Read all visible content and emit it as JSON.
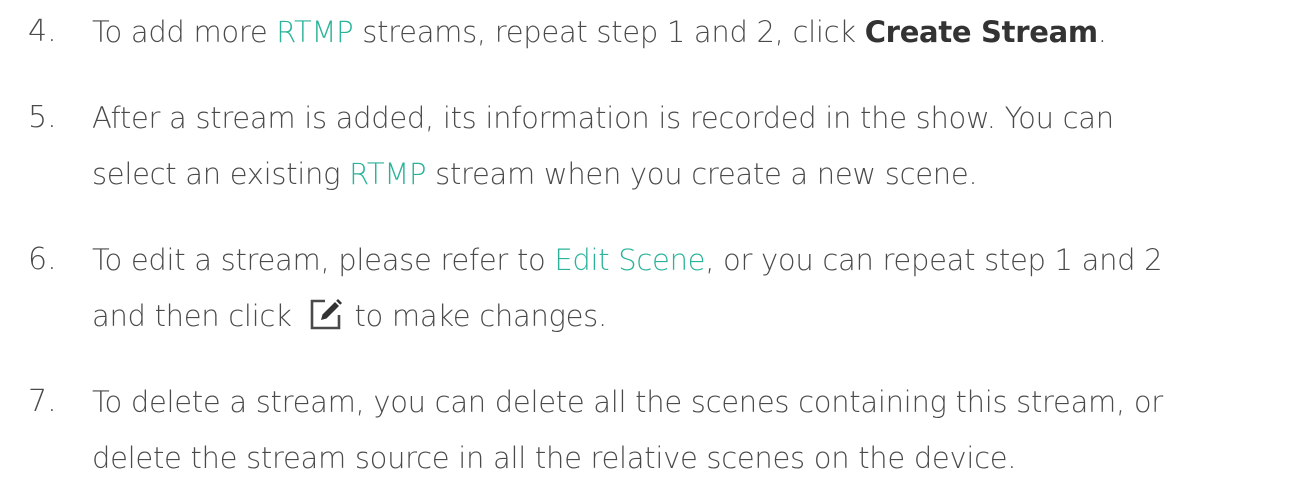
{
  "steps": [
    {
      "number": "4.",
      "lines": [
        {
          "parts": [
            {
              "text": "To add more ",
              "style": "plain"
            },
            {
              "text": "RTMP",
              "style": "link"
            },
            {
              "text": " streams, repeat step 1 and 2, click ",
              "style": "plain"
            },
            {
              "text": "Create Stream",
              "style": "bold"
            },
            {
              "text": ".",
              "style": "plain"
            }
          ]
        }
      ]
    },
    {
      "number": "5.",
      "lines": [
        {
          "parts": [
            {
              "text": "After a stream is added, its information is recorded in the show. You can",
              "style": "plain"
            }
          ]
        },
        {
          "parts": [
            {
              "text": "select an existing ",
              "style": "plain"
            },
            {
              "text": "RTMP",
              "style": "link"
            },
            {
              "text": " stream when you create a new scene.",
              "style": "plain"
            }
          ]
        }
      ]
    },
    {
      "number": "6.",
      "lines": [
        {
          "parts": [
            {
              "text": "To edit a stream, please refer to ",
              "style": "plain"
            },
            {
              "text": "Edit Scene",
              "style": "link"
            },
            {
              "text": ", or you can repeat step 1 and 2",
              "style": "plain"
            }
          ]
        },
        {
          "parts": [
            {
              "text": "and then click ",
              "style": "plain"
            },
            {
              "icon": "edit-icon"
            },
            {
              "text": "to make changes.",
              "style": "plain"
            }
          ]
        }
      ]
    },
    {
      "number": "7.",
      "lines": [
        {
          "parts": [
            {
              "text": "To delete a stream, you can delete all the scenes containing this stream, or",
              "style": "plain"
            }
          ]
        },
        {
          "parts": [
            {
              "text": "delete the stream source in all the relative scenes on the device.",
              "style": "plain"
            }
          ]
        }
      ]
    }
  ],
  "colors": {
    "text": "#4a4a4a",
    "link": "#2ab39a",
    "bold": "#333333"
  }
}
